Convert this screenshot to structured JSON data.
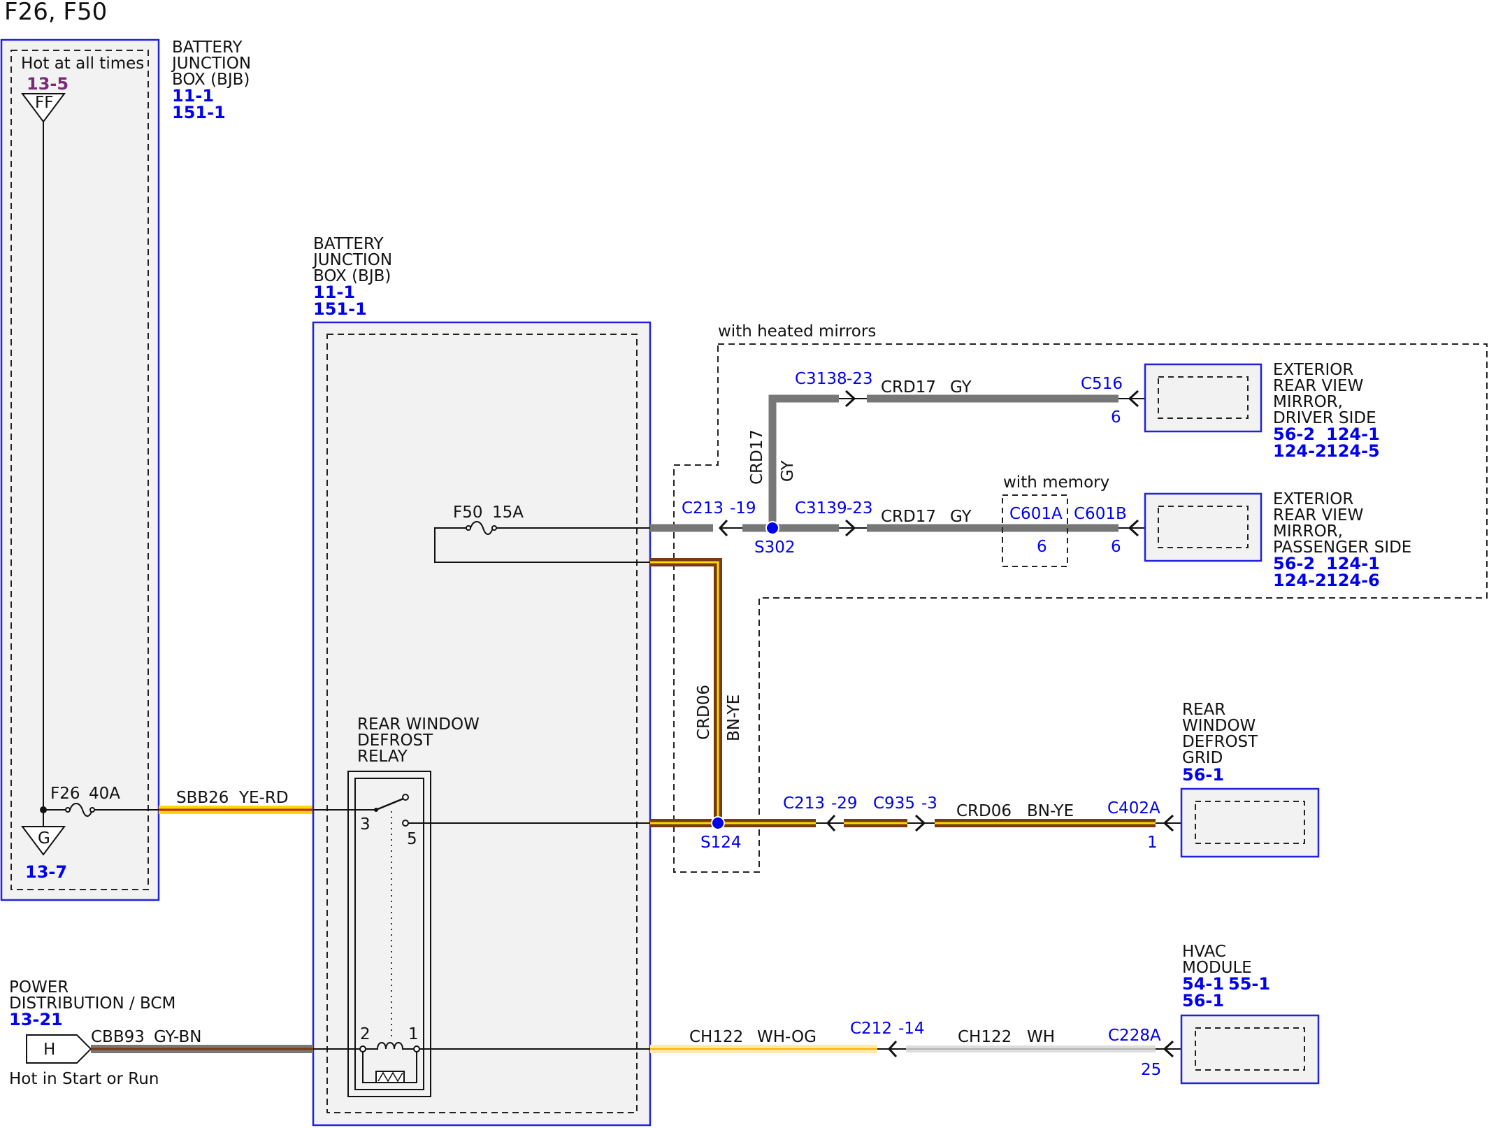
{
  "title": "F26, F50",
  "colors": {
    "ref_blue": "#0000ee",
    "ref_purple": "#7a2a7a",
    "box_outline": "#2222dd",
    "box_fill": "#f2f2f2",
    "wire_gray": "#777777",
    "wire_brown": "#7a3a10",
    "wire_yellow": "#ffd800",
    "wire_orange": "#ffb000",
    "wire_white": "#cccccc"
  },
  "bjb_left": {
    "name_lines": [
      "BATTERY",
      "JUNCTION",
      "BOX (BJB)"
    ],
    "refs": [
      "11-1",
      "151-1"
    ],
    "hot_label": "Hot at all times",
    "top_ref": "13-5",
    "top_symbol": "FF",
    "bottom_symbol": "G",
    "bottom_ref": "13-7",
    "fuse": "F26",
    "fuse_rating": "40A"
  },
  "bjb_center": {
    "name_lines": [
      "BATTERY",
      "JUNCTION",
      "BOX (BJB)"
    ],
    "refs": [
      "11-1",
      "151-1"
    ],
    "fuse": "F50",
    "fuse_rating": "15A"
  },
  "relay": {
    "name_lines": [
      "REAR WINDOW",
      "DEFROST",
      "RELAY"
    ],
    "pins": [
      "3",
      "5",
      "2",
      "1"
    ]
  },
  "groups": {
    "heated_mirrors": "with heated mirrors",
    "memory": "with memory"
  },
  "splices": [
    "S302",
    "S124"
  ],
  "connectors": {
    "c213_19": {
      "name": "C213",
      "pin": "-19"
    },
    "c213_29": {
      "name": "C213",
      "pin": "-29"
    },
    "c3138": {
      "name": "C3138",
      "pin": "-23"
    },
    "c3139": {
      "name": "C3139",
      "pin": "-23"
    },
    "c516": {
      "name": "C516",
      "pin": "6"
    },
    "c601a": {
      "name": "C601A",
      "pin": "6"
    },
    "c601b": {
      "name": "C601B",
      "pin": "6"
    },
    "c935": {
      "name": "C935",
      "pin": "-3"
    },
    "c402a": {
      "name": "C402A",
      "pin": "1"
    },
    "c212": {
      "name": "C212",
      "pin": "-14"
    },
    "c228a": {
      "name": "C228A",
      "pin": "25"
    }
  },
  "wires": {
    "sbb26": {
      "circuit": "SBB26",
      "color": "YE-RD"
    },
    "crd17_h1": {
      "circuit": "CRD17",
      "color": "GY"
    },
    "crd17_h2": {
      "circuit": "CRD17",
      "color": "GY"
    },
    "crd17_v": {
      "circuit": "CRD17",
      "color": "GY"
    },
    "crd06_v": {
      "circuit": "CRD06",
      "color": "BN-YE"
    },
    "crd06_h": {
      "circuit": "CRD06",
      "color": "BN-YE"
    },
    "cbb93": {
      "circuit": "CBB93",
      "color": "GY-BN"
    },
    "ch122_a": {
      "circuit": "CH122",
      "color": "WH-OG"
    },
    "ch122_b": {
      "circuit": "CH122",
      "color": "WH"
    }
  },
  "components": {
    "mirror_driver": {
      "name_lines": [
        "EXTERIOR",
        "REAR VIEW",
        "MIRROR,",
        "DRIVER SIDE"
      ],
      "refs": [
        [
          "56-2",
          "124-1"
        ],
        [
          "124-2",
          "124-5"
        ]
      ]
    },
    "mirror_passenger": {
      "name_lines": [
        "EXTERIOR",
        "REAR VIEW",
        "MIRROR,",
        "PASSENGER SIDE"
      ],
      "refs": [
        [
          "56-2",
          "124-1"
        ],
        [
          "124-2",
          "124-6"
        ]
      ]
    },
    "defrost_grid": {
      "name_lines": [
        "REAR",
        "WINDOW",
        "DEFROST",
        "GRID"
      ],
      "refs": [
        [
          "56-1"
        ]
      ]
    },
    "hvac": {
      "name_lines": [
        "HVAC",
        "MODULE"
      ],
      "refs": [
        [
          "54-1",
          "55-1"
        ],
        [
          "56-1"
        ]
      ]
    }
  },
  "power_source": {
    "name_lines": [
      "POWER",
      "DISTRIBUTION / BCM"
    ],
    "ref": "13-21",
    "symbol": "H",
    "note": "Hot in Start or Run"
  }
}
